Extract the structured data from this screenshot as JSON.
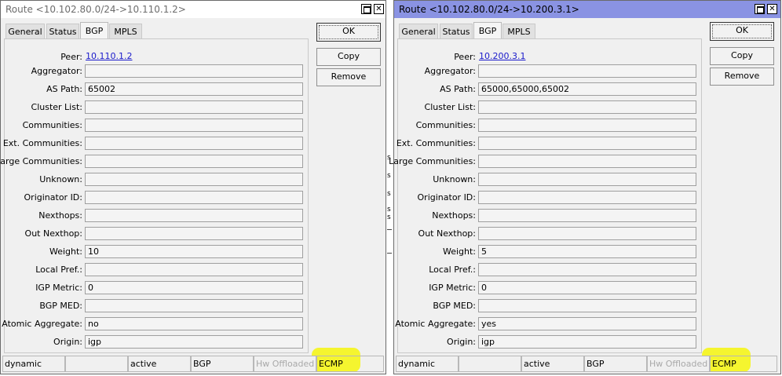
{
  "left_window": {
    "title": "Route <10.102.80.0/24->10.110.1.2>",
    "tabs": [
      "General",
      "Status",
      "BGP",
      "MPLS"
    ],
    "active_tab": "BGP",
    "buttons": {
      "ok": "OK",
      "copy": "Copy",
      "remove": "Remove"
    },
    "fields": [
      {
        "label": "Peer:",
        "value": "10.110.1.2",
        "link": true
      },
      {
        "label": "Aggregator:",
        "value": ""
      },
      {
        "label": "AS Path:",
        "value": "65002"
      },
      {
        "label": "Cluster List:",
        "value": ""
      },
      {
        "label": "Communities:",
        "value": ""
      },
      {
        "label": "Ext. Communities:",
        "value": ""
      },
      {
        "label": "Large Communities:",
        "value": ""
      },
      {
        "label": "Unknown:",
        "value": ""
      },
      {
        "label": "Originator ID:",
        "value": ""
      },
      {
        "label": "Nexthops:",
        "value": ""
      },
      {
        "label": "Out Nexthop:",
        "value": ""
      },
      {
        "label": "Weight:",
        "value": "10"
      },
      {
        "label": "Local Pref.:",
        "value": ""
      },
      {
        "label": "IGP Metric:",
        "value": "0"
      },
      {
        "label": "BGP MED:",
        "value": ""
      },
      {
        "label": "Atomic Aggregate:",
        "value": "no"
      },
      {
        "label": "Origin:",
        "value": "igp"
      }
    ],
    "status": [
      "dynamic",
      "",
      "active",
      "BGP",
      "Hw Offloaded",
      "ECMP"
    ]
  },
  "right_window": {
    "title": "Route <10.102.80.0/24->10.200.3.1>",
    "tabs": [
      "General",
      "Status",
      "BGP",
      "MPLS"
    ],
    "active_tab": "BGP",
    "buttons": {
      "ok": "OK",
      "copy": "Copy",
      "remove": "Remove"
    },
    "fields": [
      {
        "label": "Peer:",
        "value": "10.200.3.1",
        "link": true
      },
      {
        "label": "Aggregator:",
        "value": ""
      },
      {
        "label": "AS Path:",
        "value": "65000,65000,65002"
      },
      {
        "label": "Cluster List:",
        "value": ""
      },
      {
        "label": "Communities:",
        "value": ""
      },
      {
        "label": "Ext. Communities:",
        "value": ""
      },
      {
        "label": "Large Communities:",
        "value": ""
      },
      {
        "label": "Unknown:",
        "value": ""
      },
      {
        "label": "Originator ID:",
        "value": ""
      },
      {
        "label": "Nexthops:",
        "value": ""
      },
      {
        "label": "Out Nexthop:",
        "value": ""
      },
      {
        "label": "Weight:",
        "value": "5"
      },
      {
        "label": "Local Pref.:",
        "value": ""
      },
      {
        "label": "IGP Metric:",
        "value": "0"
      },
      {
        "label": "BGP MED:",
        "value": ""
      },
      {
        "label": "Atomic Aggregate:",
        "value": "yes"
      },
      {
        "label": "Origin:",
        "value": "igp"
      }
    ],
    "status": [
      "dynamic",
      "",
      "active",
      "BGP",
      "Hw Offloaded",
      "ECMP"
    ]
  },
  "titlebar_buttons": {
    "maximize_icon": "maximize-icon",
    "close_glyph": "✕"
  },
  "colors": {
    "highlight": "#f5f51a",
    "link": "#1a1acb",
    "active_title": "#8a93e3"
  }
}
